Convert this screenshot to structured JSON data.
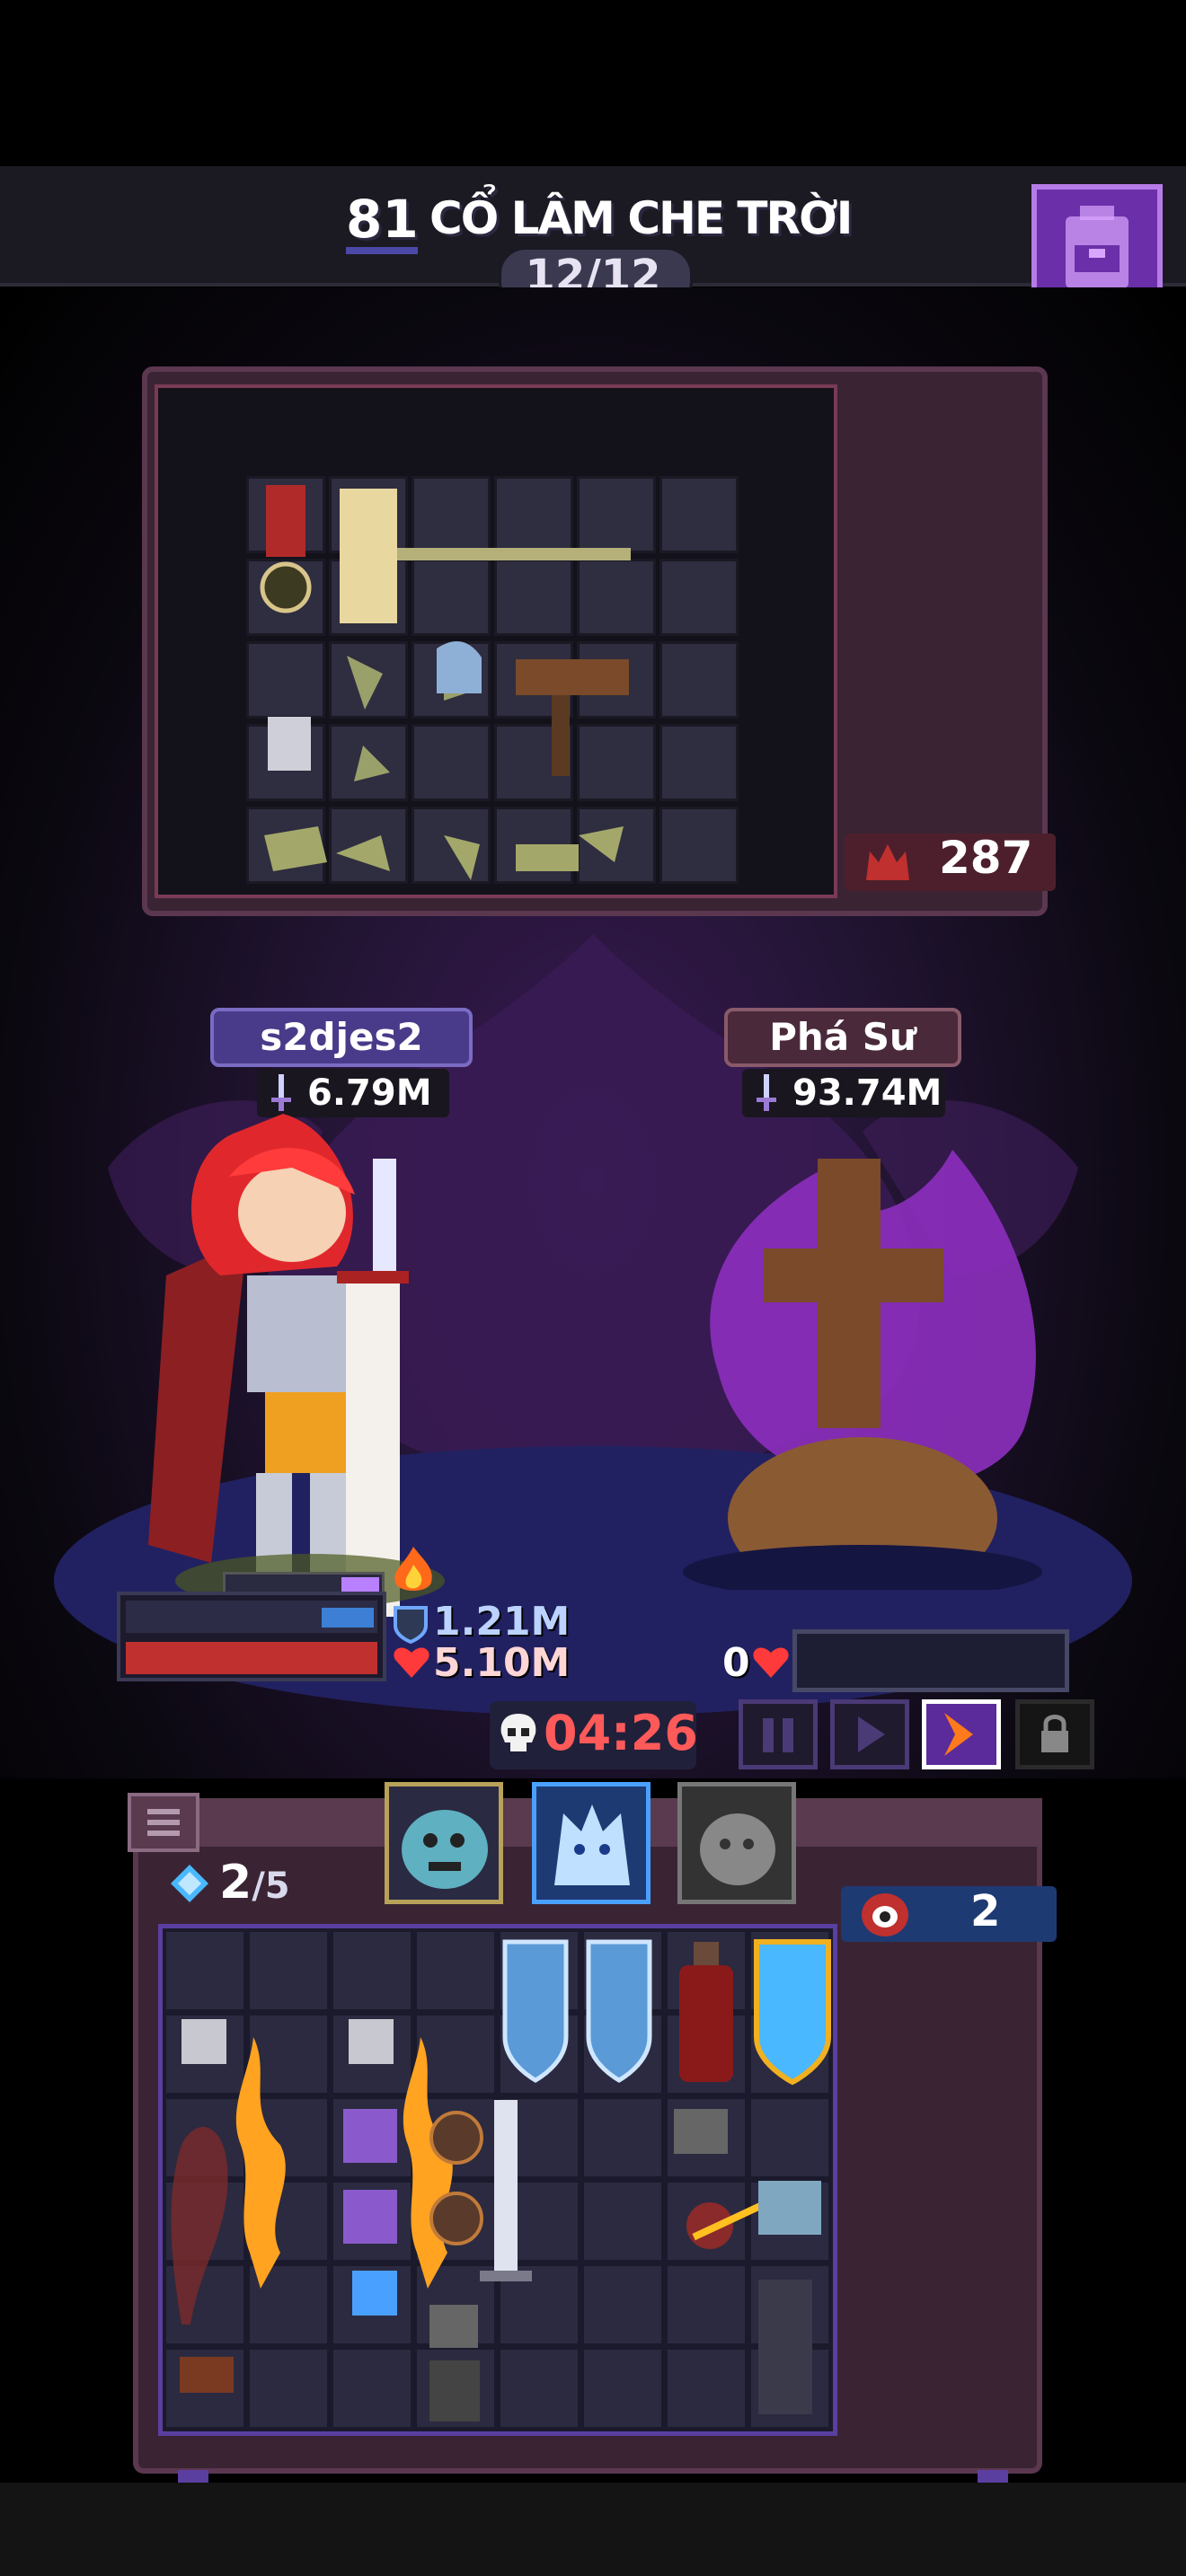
{
  "header": {
    "stage_number": "81",
    "stage_name": "CỔ LÂM CHE TRỜI",
    "wave": "12/12"
  },
  "top_grid": {
    "enemy_count": "287"
  },
  "player": {
    "name": "s2djes2",
    "power": "6.79M",
    "shield": "1.21M",
    "hp": "5.10M"
  },
  "enemy": {
    "name": "Phá Sư",
    "power": "93.74M",
    "hp": "0"
  },
  "battle": {
    "timer": "04:26"
  },
  "bottom_panel": {
    "gems": "2",
    "gems_max": "/5",
    "demon_count": "2"
  },
  "colors": {
    "accent_purple": "#6b2fa9",
    "hp_red": "#c0302e",
    "shield_blue": "#3c7fd4",
    "timer_red": "#ff5a5a"
  },
  "icons": [
    "backpack-icon",
    "sword-icon",
    "skull-icon",
    "heart-icon",
    "shield-icon",
    "pause-icon",
    "play-icon",
    "fast-forward-icon",
    "lock-icon",
    "menu-icon",
    "gem-icon",
    "demon-icon",
    "fire-icon"
  ]
}
